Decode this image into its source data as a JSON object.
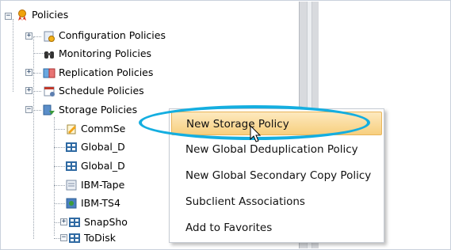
{
  "tree": {
    "root_label": "Policies",
    "items": [
      {
        "label": "Configuration Policies",
        "icon": "configuration-policy-icon"
      },
      {
        "label": "Monitoring Policies",
        "icon": "binoculars-icon"
      },
      {
        "label": "Replication Policies",
        "icon": "replication-policy-icon"
      },
      {
        "label": "Schedule Policies",
        "icon": "calendar-icon"
      },
      {
        "label": "Storage Policies",
        "icon": "storage-policy-icon"
      }
    ],
    "children": [
      {
        "label": "CommSe",
        "icon": "pencil-policy-icon"
      },
      {
        "label": "Global_D",
        "icon": "storage-node-icon"
      },
      {
        "label": "Global_D",
        "icon": "storage-node-icon"
      },
      {
        "label": "IBM-Tape",
        "icon": "tape-icon"
      },
      {
        "label": "IBM-TS4",
        "icon": "tape-library-icon"
      },
      {
        "label": "SnapSho",
        "icon": "storage-node-icon"
      },
      {
        "label": "ToDisk",
        "icon": "storage-node-icon"
      }
    ]
  },
  "context_menu": {
    "items": [
      {
        "label": "New Storage Policy",
        "highlighted": true
      },
      {
        "label": "New Global Deduplication Policy"
      },
      {
        "label": "New Global Secondary Copy Policy"
      },
      {
        "label": "Subclient Associations"
      },
      {
        "label": "Add to Favorites"
      }
    ]
  },
  "colors": {
    "highlight_oval": "#14aee0",
    "menu_highlight": "#f7cf7e"
  }
}
